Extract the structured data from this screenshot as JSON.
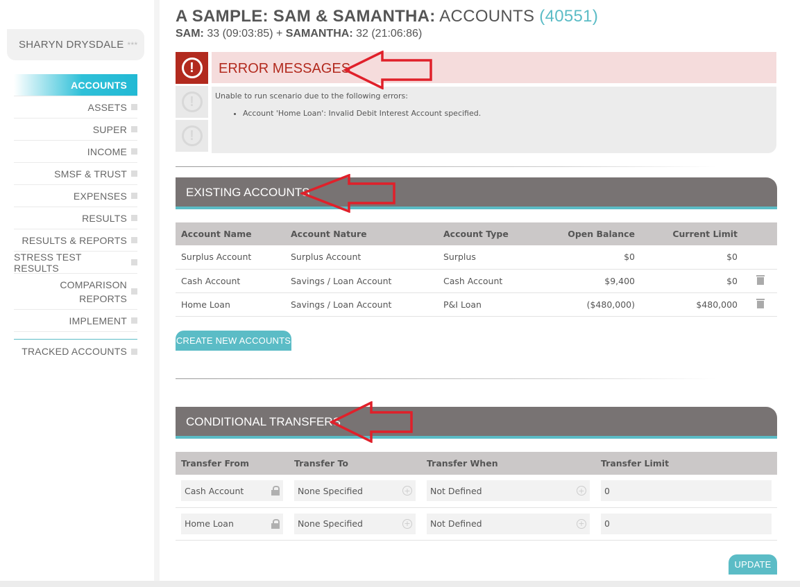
{
  "sidebar": {
    "user_name": "SHARYN DRYSDALE",
    "user_stars": "***",
    "items": [
      {
        "label": "ACCOUNTS"
      },
      {
        "label": "ASSETS"
      },
      {
        "label": "SUPER"
      },
      {
        "label": "INCOME"
      },
      {
        "label": "SMSF & TRUST"
      },
      {
        "label": "EXPENSES"
      },
      {
        "label": "RESULTS"
      },
      {
        "label": "RESULTS & REPORTS"
      },
      {
        "label": "STRESS TEST RESULTS"
      },
      {
        "label": "COMPARISON REPORTS"
      },
      {
        "label": "IMPLEMENT"
      }
    ],
    "tracked": "TRACKED ACCOUNTS"
  },
  "header": {
    "title_bold": "A SAMPLE: SAM & SAMANTHA:",
    "title_light": "ACCOUNTS",
    "title_id": "(40551)",
    "sub_sam_label": "SAM:",
    "sub_sam_value": "33 (09:03:85) +",
    "sub_samantha_label": "SAMANTHA:",
    "sub_samantha_value": "32 (21:06:86)"
  },
  "errors": {
    "title": "ERROR MESSAGES",
    "intro": "Unable to run scenario due to the following errors:",
    "items": [
      "Account 'Home Loan': Invalid Debit Interest Account specified."
    ]
  },
  "existing_accounts": {
    "title": "EXISTING ACCOUNTS",
    "columns": [
      "Account Name",
      "Account Nature",
      "Account Type",
      "Open Balance",
      "Current Limit"
    ],
    "rows": [
      {
        "name": "Surplus Account",
        "nature": "Surplus Account",
        "type": "Surplus",
        "open": "$0",
        "limit": "$0"
      },
      {
        "name": "Cash Account",
        "nature": "Savings / Loan Account",
        "type": "Cash Account",
        "open": "$9,400",
        "limit": "$0"
      },
      {
        "name": "Home Loan",
        "nature": "Savings / Loan Account",
        "type": "P&I Loan",
        "open": "($480,000)",
        "limit": "$480,000"
      }
    ],
    "create_button": "CREATE NEW ACCOUNTS"
  },
  "conditional_transfers": {
    "title": "CONDITIONAL TRANSFERS",
    "columns": [
      "Transfer From",
      "Transfer To",
      "Transfer When",
      "Transfer Limit"
    ],
    "rows": [
      {
        "from": "Cash Account",
        "to": "None Specified",
        "when": "Not Defined",
        "limit": "0"
      },
      {
        "from": "Home Loan",
        "to": "None Specified",
        "when": "Not Defined",
        "limit": "0"
      }
    ],
    "update_button": "UPDATE"
  },
  "colors": {
    "accent": "#5bbcc6",
    "error_red": "#b22a1e",
    "section_header": "#787373",
    "annotation_arrow": "#e0202a"
  }
}
